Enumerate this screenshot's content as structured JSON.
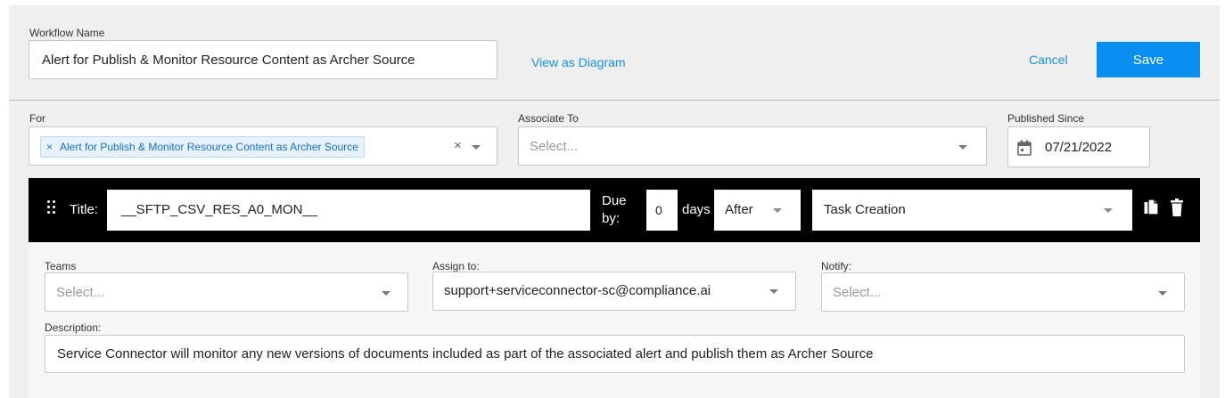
{
  "header": {
    "workflow_name_label": "Workflow Name",
    "workflow_name_value": "Alert for Publish & Monitor Resource Content as Archer Source",
    "view_diagram_link": "View as Diagram",
    "cancel_label": "Cancel",
    "save_label": "Save"
  },
  "for_field": {
    "label": "For",
    "chip": "Alert for Publish & Monitor Resource Content as Archer Source",
    "chip_remove": "×",
    "clear": "×"
  },
  "associate_to": {
    "label": "Associate To",
    "placeholder": "Select..."
  },
  "published_since": {
    "label": "Published Since",
    "value": "07/21/2022"
  },
  "task": {
    "title_label": "Title:",
    "title_value": "__SFTP_CSV_RES_A0_MON__",
    "due_by_line1": "Due",
    "due_by_line2": "by:",
    "days_value": "0",
    "days_label": "days",
    "relation_value": "After",
    "event_value": "Task Creation"
  },
  "details": {
    "teams_label": "Teams",
    "teams_placeholder": "Select...",
    "assign_label": "Assign to:",
    "assign_value": "support+serviceconnector-sc@compliance.ai",
    "notify_label": "Notify:",
    "notify_placeholder": "Select...",
    "description_label": "Description:",
    "description_value": "Service Connector will monitor any new versions of documents included as part of the associated alert and publish them as Archer Source"
  },
  "colors": {
    "accent": "#0a8ef0",
    "link": "#1a8fe3",
    "task_bar": "#000000",
    "panel": "#efefef"
  },
  "icons": [
    "calendar-icon",
    "drag-handle-icon",
    "copy-icon",
    "trash-icon",
    "chevron-down-icon",
    "close-icon"
  ]
}
